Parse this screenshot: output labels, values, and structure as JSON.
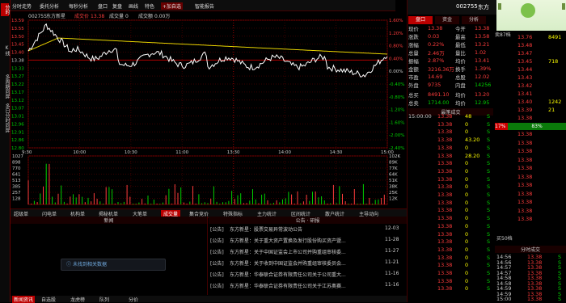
{
  "left_tabs": [
    "分时",
    "K线",
    "多周期同屏",
    "多日分时同屏"
  ],
  "toolbar": [
    "分时走势",
    "委托分析",
    "每秒分析",
    "盘口",
    "复盘",
    "画线",
    "特色",
    "+加自选",
    "",
    "智能报告"
  ],
  "chart_header": {
    "code": "002755",
    "name": "东方新星",
    "price_label": "成交价",
    "price": "13.38",
    "vol_label": "成交量",
    "vol": "0",
    "amt_label": "成交额",
    "amt": "0.00万"
  },
  "price_ticks": [
    "13.59",
    "13.55",
    "13.50",
    "13.45",
    "13.40",
    "13.38",
    "13.33",
    "13.27",
    "13.22",
    "13.17",
    "13.12",
    "13.07",
    "13.01",
    "12.96",
    "12.91",
    "12.86",
    "12.80"
  ],
  "pct_ticks": [
    "1.60%",
    "1.20%",
    "0.80%",
    "0.40%",
    "0.00%",
    "-0.40%",
    "-0.80%",
    "-1.20%",
    "-1.60%",
    "-2.00%",
    "-2.40%"
  ],
  "time_labels": [
    "9:30",
    "10:00",
    "10:30",
    "11:00",
    "13:30",
    "14:00",
    "14:30",
    "15:00"
  ],
  "vol_ticks": [
    "1027",
    "898",
    "770",
    "641",
    "513",
    "385",
    "257",
    "128"
  ],
  "vol_ticks_right": [
    "102K",
    "89K",
    "77K",
    "64K",
    "51K",
    "38K",
    "25K",
    "12K"
  ],
  "bottom_tabs": [
    "超级单",
    "闪电单",
    "机构单",
    "揭秘机单",
    "大笔单",
    "成交量",
    "集合竞价",
    "特殊指标",
    "主力统计",
    "区间统计",
    "散户统计",
    "主导动向"
  ],
  "bottom_active": "成交量",
  "panel_left_title": "新闻",
  "panel_right_title": "公告 · 研报",
  "no_data": "未找到相关数据",
  "news": [
    {
      "tag": "[公告]",
      "text": "东方新星：股票交易异常波动公告",
      "date": "12-03"
    },
    {
      "tag": "[公告]",
      "text": "东方新星：关于重大资产置换及发行股份购买资产暨...",
      "date": "11-28"
    },
    {
      "tag": "[公告]",
      "text": "东方新星：关于中国证监会上市公司并购重组审核委...",
      "date": "11-27"
    },
    {
      "tag": "[公告]",
      "text": "东方新星：关于收到中国证监会并购重组审核委员会...",
      "date": "11-21"
    },
    {
      "tag": "[公告]",
      "text": "东方新星：华泰联合证券有限责任公司关于公司重大...",
      "date": "11-16"
    },
    {
      "tag": "[公告]",
      "text": "东方新星：华泰联合证券有限责任公司关于江苏奥赛...",
      "date": "11-16"
    }
  ],
  "bottom_nav": [
    "新闻资讯",
    "自选股",
    "龙虎榜",
    "队列",
    "分价"
  ],
  "right_header": {
    "code": "002755",
    "name": "东方"
  },
  "right_tabs": [
    "盘口",
    "资金",
    "分析"
  ],
  "quote": [
    [
      "现价",
      "13.38",
      "今开",
      "13.38"
    ],
    [
      "涨跌",
      "0.03",
      "最高",
      "13.58"
    ],
    [
      "涨幅",
      "0.22%",
      "最低",
      "13.21"
    ],
    [
      "总量",
      "2.46万",
      "量比",
      "1.02"
    ],
    [
      "振幅",
      "2.87%",
      "均价",
      "13.41"
    ],
    [
      "金额",
      "3216.36万",
      "换手",
      "1.39%"
    ],
    [
      "市盈",
      "14.69",
      "总股",
      "12.02"
    ],
    [
      "外盘",
      "9735",
      "内盘",
      "14256"
    ]
  ],
  "zongmai": {
    "buy_label": "总买",
    "buy": "8491.10",
    "buy_avg_label": "均价",
    "buy_avg": "13.20",
    "sell_label": "总卖",
    "sell": "1714.00",
    "sell_avg_label": "均价",
    "sell_avg": "12.95"
  },
  "recent_label": "最笔成交",
  "trades": [
    [
      "15:00:00",
      "13.38",
      "48",
      "S"
    ],
    [
      "",
      "13.38",
      "0",
      "S"
    ],
    [
      "",
      "13.38",
      "0",
      "S"
    ],
    [
      "",
      "13.38",
      "43.20",
      "S"
    ],
    [
      "",
      "13.38",
      "0",
      "S"
    ],
    [
      "",
      "13.38",
      "28.20",
      "S"
    ],
    [
      "",
      "13.38",
      "0",
      "S"
    ],
    [
      "",
      "13.38",
      "0",
      "S"
    ],
    [
      "",
      "13.38",
      "0",
      "S"
    ],
    [
      "",
      "13.38",
      "0",
      "S"
    ],
    [
      "",
      "13.38",
      "0",
      "S"
    ],
    [
      "",
      "13.38",
      "0",
      "S"
    ],
    [
      "",
      "13.38",
      "0",
      "S"
    ],
    [
      "",
      "13.38",
      "0",
      "S"
    ],
    [
      "",
      "13.38",
      "0",
      "S"
    ],
    [
      "",
      "13.38",
      "0",
      "S"
    ],
    [
      "",
      "13.38",
      "0",
      "S"
    ],
    [
      "",
      "13.38",
      "0",
      "S"
    ],
    [
      "",
      "13.38",
      "0",
      "S"
    ],
    [
      "",
      "13.38",
      "0",
      "S"
    ],
    [
      "",
      "13.38",
      "0",
      "S"
    ],
    [
      "",
      "13.38",
      "0",
      "S"
    ],
    [
      "",
      "13.38",
      "0",
      "S"
    ]
  ],
  "ratio": {
    "left": "17%",
    "right": "83%"
  },
  "sell_book_label": "卖87档",
  "sell_book": [
    [
      "13.76",
      "8491"
    ],
    [
      "13.48",
      ""
    ],
    [
      "13.47",
      ""
    ],
    [
      "13.45",
      "718"
    ],
    [
      "13.44",
      ""
    ],
    [
      "13.43",
      ""
    ],
    [
      "13.42",
      ""
    ],
    [
      "13.41",
      ""
    ],
    [
      "13.40",
      "1242"
    ],
    [
      "13.39",
      "21"
    ],
    [
      "13.38",
      ""
    ]
  ],
  "buy_book_label": "买50档",
  "buy_book": [
    [
      "13.38",
      ""
    ],
    [
      "13.38",
      ""
    ],
    [
      "13.38",
      ""
    ],
    [
      "13.38",
      ""
    ],
    [
      "13.38",
      ""
    ],
    [
      "13.38",
      ""
    ],
    [
      "13.38",
      ""
    ],
    [
      "13.38",
      ""
    ],
    [
      "13.38",
      ""
    ],
    [
      "13.38",
      ""
    ],
    [
      "13.38",
      ""
    ]
  ],
  "right_bottom_header": "分时成交",
  "fenshi_rows": [
    [
      "14:56",
      "13.38",
      "S"
    ],
    [
      "14:56",
      "13.38",
      "S"
    ],
    [
      "14:57",
      "13.38",
      "S"
    ],
    [
      "14:57",
      "13.38",
      "S"
    ],
    [
      "14:58",
      "13.38",
      "S"
    ],
    [
      "14:58",
      "13.38",
      "S"
    ],
    [
      "14:59",
      "13.38",
      "S"
    ],
    [
      "14:59",
      "13.38",
      "S"
    ],
    [
      "15:00",
      "13.38",
      "S"
    ]
  ],
  "colors": {
    "up": "#ff3c3c",
    "down": "#00d000",
    "avg": "#e6d200",
    "price": "#ffffff",
    "grid": "#5a0000"
  }
}
